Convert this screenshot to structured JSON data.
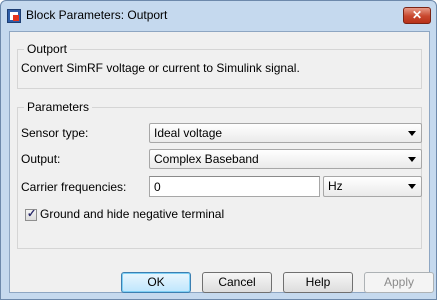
{
  "window": {
    "title": "Block Parameters: Outport",
    "close_glyph": "✕"
  },
  "outport": {
    "legend": "Outport",
    "description": "Convert SimRF voltage or current to Simulink signal."
  },
  "parameters": {
    "legend": "Parameters",
    "sensor_type_label": "Sensor type:",
    "sensor_type_value": "Ideal voltage",
    "output_label": "Output:",
    "output_value": "Complex Baseband",
    "carrier_label": "Carrier frequencies:",
    "carrier_value": "0",
    "carrier_unit": "Hz",
    "ground_label": "Ground and hide negative terminal",
    "ground_checked": true,
    "check_glyph": "✓"
  },
  "buttons": {
    "ok": "OK",
    "cancel": "Cancel",
    "help": "Help",
    "apply": "Apply"
  },
  "icons": {
    "app": "simulink-block-icon",
    "close": "close-icon",
    "dropdown": "chevron-down-icon"
  }
}
